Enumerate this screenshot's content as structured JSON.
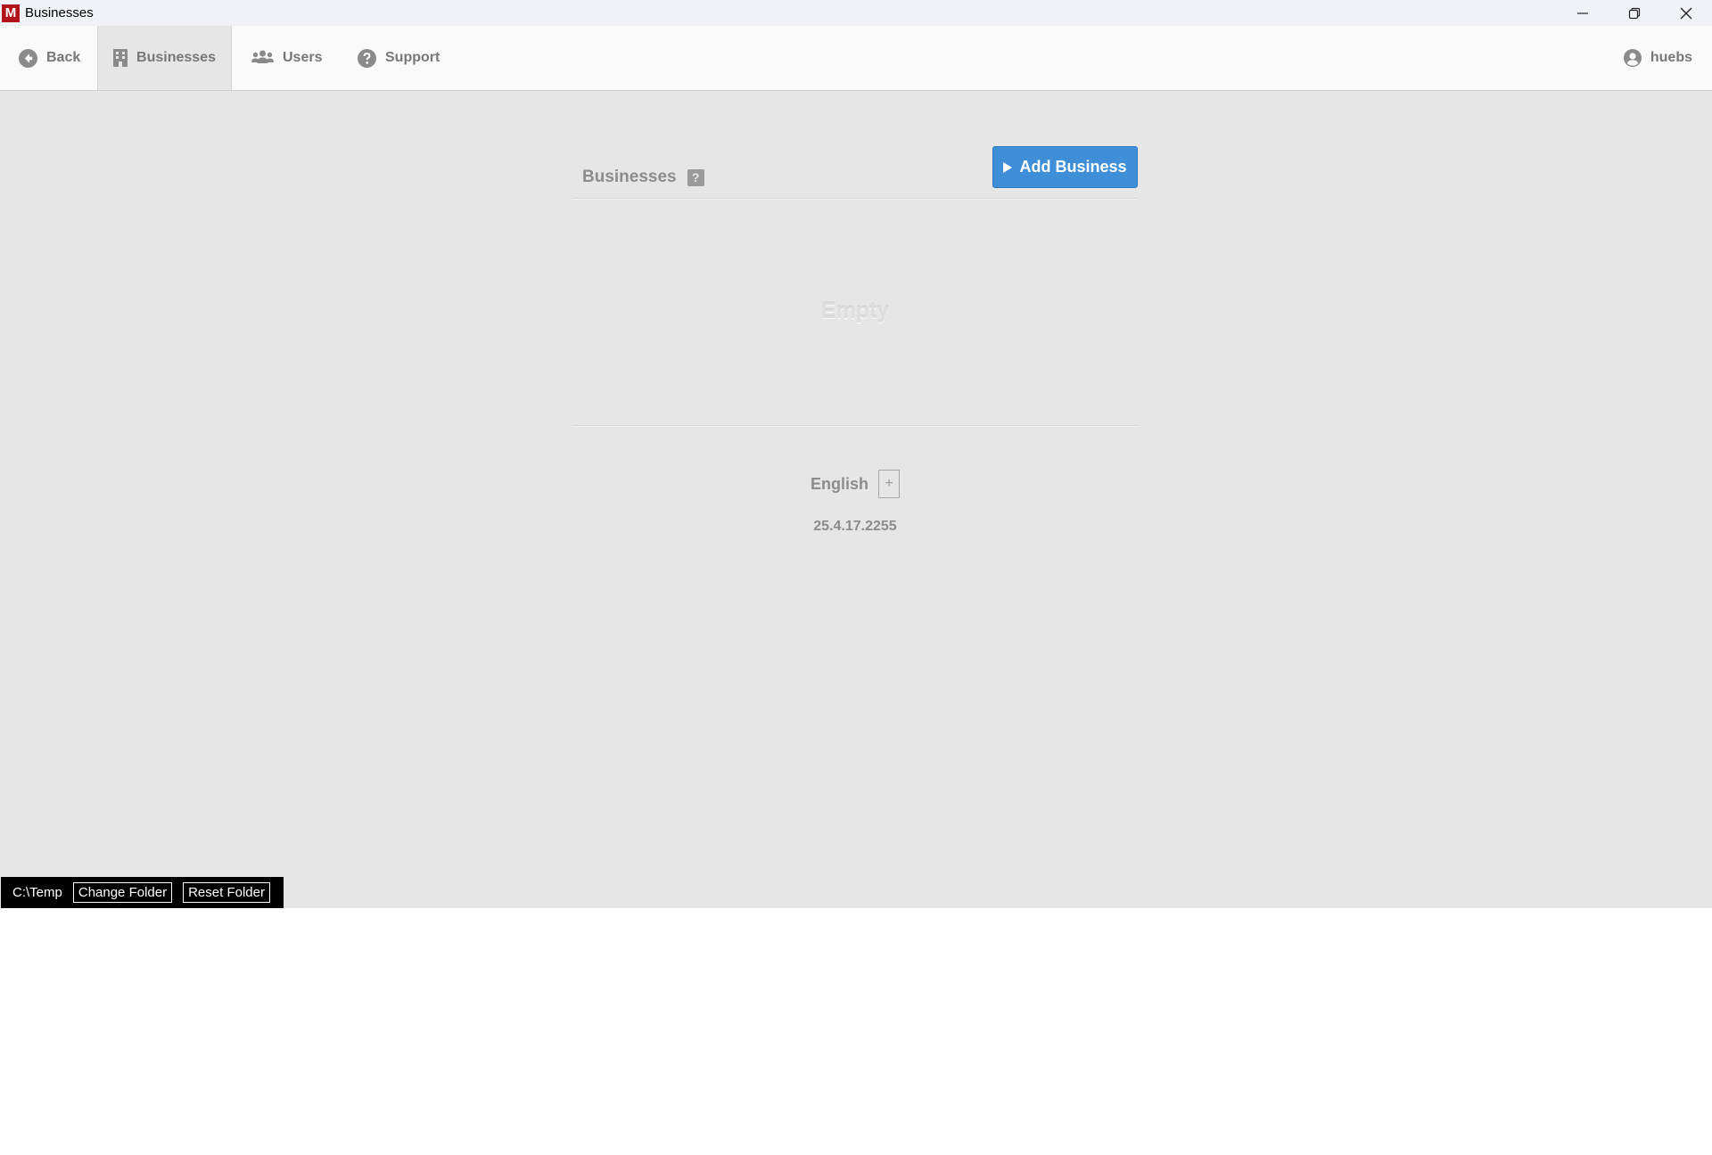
{
  "window": {
    "app_icon_letter": "M",
    "title": "Businesses"
  },
  "nav": {
    "back": "Back",
    "businesses": "Businesses",
    "users": "Users",
    "support": "Support",
    "user": "huebs",
    "active_tab": "businesses"
  },
  "panel": {
    "title": "Businesses",
    "help_symbol": "?",
    "add_button": "Add Business",
    "empty_text": "Empty"
  },
  "footer": {
    "language": "English",
    "language_add_symbol": "+",
    "version": "25.4.17.2255"
  },
  "folder": {
    "path": "C:\\Temp",
    "change_button": "Change Folder",
    "reset_button": "Reset Folder"
  },
  "colors": {
    "accent": "#3f8fd8",
    "app_icon": "#b3121b",
    "main_background": "#e6e6e6"
  },
  "icons": {
    "back": "arrow-circle-left-icon",
    "businesses": "building-icon",
    "users": "users-group-icon",
    "support": "question-circle-icon",
    "user": "user-circle-icon",
    "add": "play-triangle-icon"
  }
}
